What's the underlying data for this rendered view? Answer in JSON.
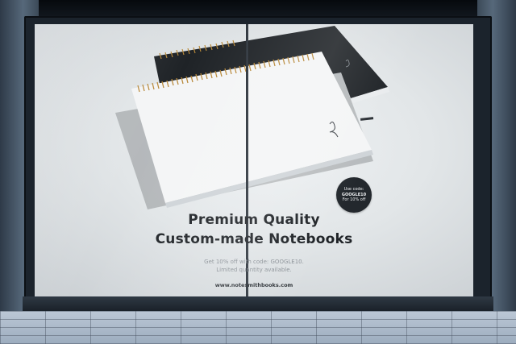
{
  "poster": {
    "headline_line1": "Premium Quality",
    "headline_line2": "Custom-made Notebooks",
    "offer_line1": "Get 10% off with code: GOOGLE10.",
    "offer_line2": "Limited quantity available.",
    "website": "www.notesmithbooks.com"
  },
  "badge": {
    "line1": "Use code:",
    "line2": "GOOGLE10",
    "line3": "For 10% off"
  },
  "colors": {
    "poster_background": "#e4e8ea",
    "badge_background": "#23282d",
    "headline_text": "#1e2226",
    "frame": "#1b232c"
  }
}
